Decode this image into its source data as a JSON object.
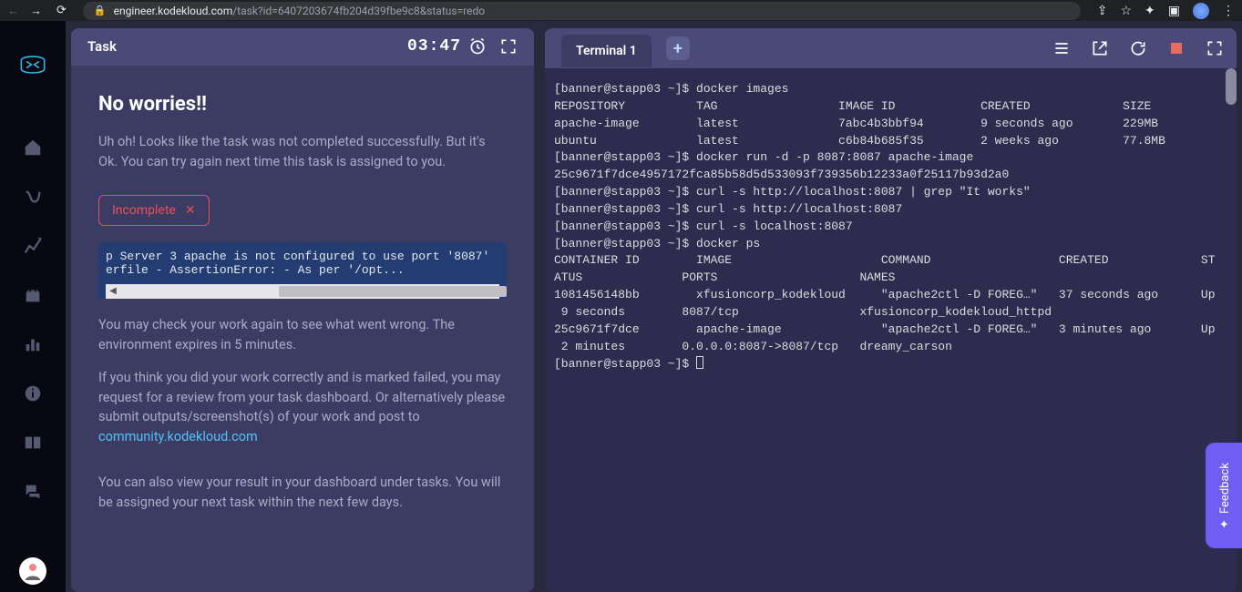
{
  "browser": {
    "url_domain": "engineer.kodekloud.com",
    "url_path": "/task?id=6407203674fb204d39fbe9c8&status=redo"
  },
  "sidebar": {
    "items": [
      "home",
      "path",
      "stats",
      "castle",
      "leaderboard",
      "info",
      "book",
      "forum"
    ]
  },
  "task": {
    "tab_label": "Task",
    "timer": "03:47",
    "heading": "No worries!!",
    "summary": "Uh oh! Looks like the task was not completed successfully. But it's Ok. You can try again next time this task is assigned to you.",
    "status_label": "Incomplete",
    "error_line1": "p Server 3 apache is not configured to use port '8087'",
    "error_line2": "erfile - AssertionError: - As per '/opt...",
    "advice1": "You may check your work again to see what went wrong. The environment expires in 5 minutes.",
    "advice2": "If you think you did your work correctly and is marked failed, you may request for a review from your task dashboard. Or alternatively please submit outputs/screenshot(s) of your work and post to ",
    "community_link": "community.kodekloud.com",
    "advice3": "You can also view your result in your dashboard under tasks. You will be assigned your next task within the next few days."
  },
  "terminal": {
    "tab_label": "Terminal 1",
    "output": "[banner@stapp03 ~]$ docker images\nREPOSITORY          TAG                 IMAGE ID            CREATED             SIZE\napache-image        latest              7abc4b3bbf94        9 seconds ago       229MB\nubuntu              latest              c6b84b685f35        2 weeks ago         77.8MB\n[banner@stapp03 ~]$ docker run -d -p 8087:8087 apache-image\n25c9671f7dce4957172fca85b58d5d533093f739356b12233a0f25117b93d2a0\n[banner@stapp03 ~]$ curl -s http://localhost:8087 | grep \"It works\"\n[banner@stapp03 ~]$ curl -s http://localhost:8087\n[banner@stapp03 ~]$ curl -s localhost:8087\n[banner@stapp03 ~]$ docker ps\nCONTAINER ID        IMAGE                     COMMAND                  CREATED             ST\nATUS              PORTS                    NAMES\n1081456148bb        xfusioncorp_kodekloud     \"apache2ctl -D FOREG…\"   37 seconds ago      Up\n 9 seconds        8087/tcp                 xfusioncorp_kodekloud_httpd\n25c9671f7dce        apache-image              \"apache2ctl -D FOREG…\"   3 minutes ago       Up\n 2 minutes        0.0.0.0:8087->8087/tcp   dreamy_carson\n[banner@stapp03 ~]$ "
  },
  "feedback": {
    "label": "Feedback"
  }
}
